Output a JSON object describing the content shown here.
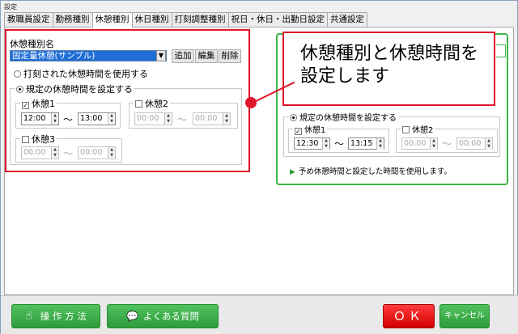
{
  "window": {
    "title": "設定"
  },
  "tabs": [
    "教職員設定",
    "勤務種別",
    "休憩種別",
    "休日種別",
    "打刻調整種別",
    "祝日・休日・出勤日設定",
    "共通設定"
  ],
  "left": {
    "type_name_label": "休憩種別名",
    "selected_type": "固定量休憩(サンプル)",
    "add_label": "追加",
    "edit_label": "編集",
    "delete_label": "削除",
    "radio_use_stamped": "打刻された休憩時間を使用する",
    "radio_use_preset": "規定の休憩時間を設定する",
    "break1": {
      "label": "休憩1",
      "start": "12:00",
      "end": "13:00"
    },
    "break2": {
      "label": "休憩2",
      "start": "00:00",
      "end": "00:00"
    },
    "break3": {
      "label": "休憩3",
      "start": "00:00",
      "end": "00:00"
    },
    "tilde": "〜"
  },
  "callout": {
    "line1": "休憩種別と休憩時間を",
    "line2": "設定します"
  },
  "right": {
    "radio_use_preset": "規定の休憩時間を設定する",
    "break1": {
      "label": "休憩1",
      "start": "12:30",
      "end": "13:15"
    },
    "break2": {
      "label": "休憩2",
      "start": "00:00",
      "end": "00:00"
    },
    "note": "予め休憩時間と設定した時間を使用します。",
    "tilde": "〜"
  },
  "footer": {
    "howto_label": "操 作 方 法",
    "faq_label": "よくある質問",
    "ok_label": "ＯＫ",
    "cancel_label": "キャンセル"
  },
  "colors": {
    "accent_red": "#e0162b",
    "green": "#3cb44b",
    "select_blue": "#1e6ed6"
  }
}
